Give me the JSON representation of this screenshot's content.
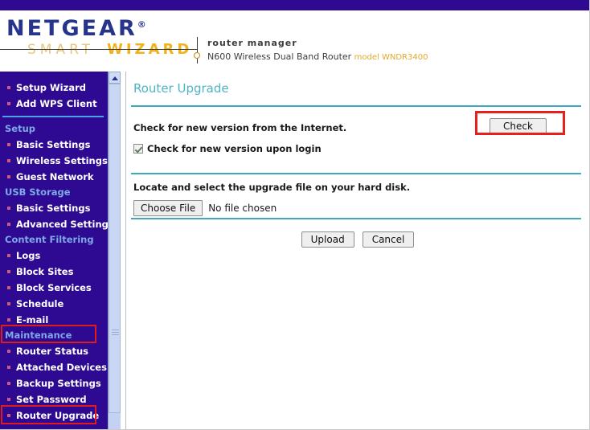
{
  "brand": {
    "logo_primary": "NETGEAR",
    "logo_tm": "®",
    "logo_smart": "SMART",
    "logo_wizard": "WIZARD",
    "tagline": "router manager",
    "device": "N600 Wireless Dual Band Router",
    "model": "model WNDR3400",
    "top_bar_color": "#2d0a91",
    "logo_color": "#27348b",
    "wizard_color": "#f0b31c"
  },
  "sidebar": {
    "background": "#2d0a91",
    "bullet_color": "#d05a7a",
    "header_color": "#7fa8e8",
    "groups": [
      {
        "header": null,
        "items": [
          {
            "label": "Setup Wizard"
          },
          {
            "label": "Add WPS Client"
          }
        ]
      },
      {
        "header": "Setup",
        "items": [
          {
            "label": "Basic Settings"
          },
          {
            "label": "Wireless Settings"
          },
          {
            "label": "Guest Network"
          }
        ]
      },
      {
        "header": "USB Storage",
        "items": [
          {
            "label": "Basic Settings"
          },
          {
            "label": "Advanced Settings"
          }
        ]
      },
      {
        "header": "Content Filtering",
        "items": [
          {
            "label": "Logs"
          },
          {
            "label": "Block Sites"
          },
          {
            "label": "Block Services"
          },
          {
            "label": "Schedule"
          },
          {
            "label": "E-mail"
          }
        ]
      },
      {
        "header": "Maintenance",
        "items": [
          {
            "label": "Router Status"
          },
          {
            "label": "Attached Devices"
          },
          {
            "label": "Backup Settings"
          },
          {
            "label": "Set Password"
          },
          {
            "label": "Router Upgrade"
          }
        ]
      }
    ]
  },
  "annotations": {
    "color": "#e8201a",
    "highlights": [
      "Maintenance",
      "Router Upgrade",
      "Check"
    ]
  },
  "main": {
    "title": "Router Upgrade",
    "title_color": "#4fb3c6",
    "rule_color": "#3fa9bd",
    "internet_check": {
      "description": "Check for new version from the Internet.",
      "button_label": "Check",
      "checkbox_label": "Check for new version upon login",
      "checkbox_checked": true
    },
    "local_file": {
      "description": "Locate and select the upgrade file on your hard disk.",
      "choose_file_label": "Choose File",
      "file_status": "No file chosen"
    },
    "actions": {
      "upload_label": "Upload",
      "cancel_label": "Cancel"
    }
  }
}
